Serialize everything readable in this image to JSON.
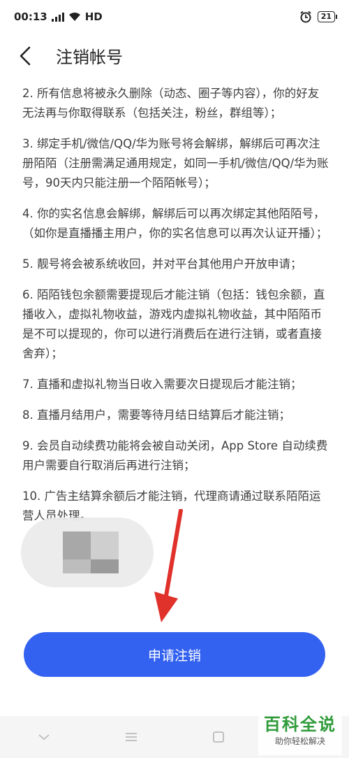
{
  "status_bar": {
    "time": "00:13",
    "network": "HD",
    "battery": "21"
  },
  "header": {
    "title": "注销帐号"
  },
  "items": [
    "2. 所有信息将被永久删除（动态、圈子等内容），你的好友无法再与你取得联系（包括关注，粉丝，群组等）；",
    "3. 绑定手机/微信/QQ/华为账号将会解绑，解绑后可再次注册陌陌（注册需满足通用规定，如同一手机/微信/QQ/华为账号，90天内只能注册一个陌陌帐号）；",
    "4. 你的实名信息会解绑，解绑后可以再次绑定其他陌陌号，（如你是直播播主用户，你的实名信息可以再次认证开播）；",
    "5. 靓号将会被系统收回，并对平台其他用户开放申请；",
    "6. 陌陌钱包余额需要提现后才能注销（包括：钱包余额，直播收入，虚拟礼物收益，游戏内虚拟礼物收益，其中陌陌币是不可以提现的，你可以进行消费后在进行注销，或者直接舍弃）；",
    "7. 直播和虚拟礼物当日收入需要次日提现后才能注销；",
    "8. 直播月结用户，需要等待月结日结算后才能注销；",
    "9. 会员自动续费功能将会被自动关闭，App Store 自动续费用户需要自行取消后再进行注销；",
    "10. 广告主结算余额后才能注销，代理商请通过联系陌陌运营人员处理。"
  ],
  "apply_button": "申请注销",
  "watermark": {
    "title": "百科全说",
    "subtitle": "助你轻松解决"
  },
  "colors": {
    "primary": "#3462f0",
    "annotation_arrow": "#e0312b",
    "watermark_green": "#2f9b3a"
  }
}
